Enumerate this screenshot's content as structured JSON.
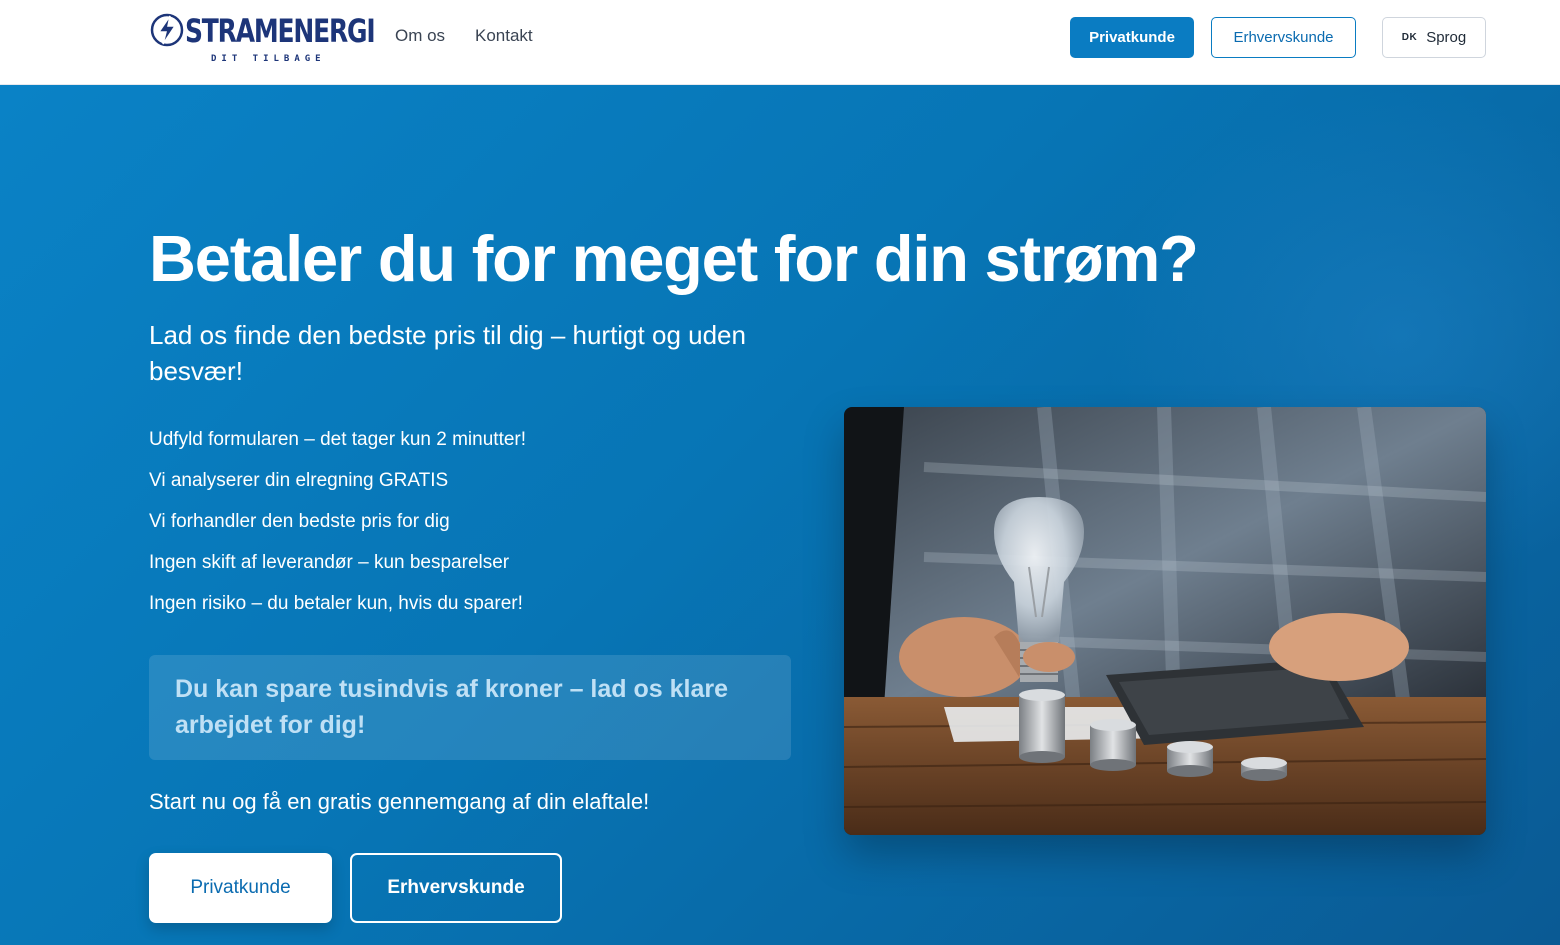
{
  "header": {
    "logo": {
      "wordmark": "STRAMENERGI",
      "tagline": "DIT TILBAGE"
    },
    "nav": [
      {
        "label": "Om os"
      },
      {
        "label": "Kontakt"
      }
    ],
    "buttons": {
      "private_label": "Privatkunde",
      "business_label": "Erhvervskunde",
      "language_flag": "DK",
      "language_label": "Sprog"
    }
  },
  "hero": {
    "headline": "Betaler du for meget for din strøm?",
    "subheadline": "Lad os finde den bedste pris til dig – hurtigt og uden besvær!",
    "bullets": [
      "Udfyld formularen – det tager kun 2 minutter!",
      "Vi analyserer din elregning GRATIS",
      "Vi forhandler den bedste pris for dig",
      "Ingen skift af leverandør – kun besparelser",
      "Ingen risiko – du betaler kun, hvis du sparer!"
    ],
    "callout": "Du kan spare tusindvis af kroner – lad os klare arbejdet for dig!",
    "cta_text": "Start nu og få en gratis gennemgang af din elaftale!",
    "buttons": {
      "private_label": "Privatkunde",
      "business_label": "Erhvervskunde"
    }
  },
  "colors": {
    "brand_navy": "#1d3579",
    "primary_blue": "#0a7cc2",
    "hero_gradient_start": "#0a82c6",
    "hero_gradient_end": "#0a5a94",
    "callout_text": "#bfe0f5"
  }
}
